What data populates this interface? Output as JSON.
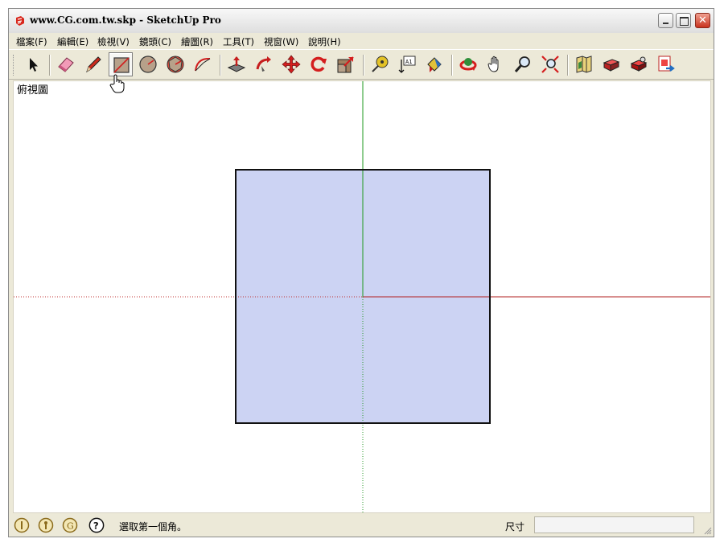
{
  "window": {
    "title": "www.CG.com.tw.skp - SketchUp Pro",
    "accent": "#cd2b1e"
  },
  "menu": [
    {
      "label": "檔案(F)"
    },
    {
      "label": "編輯(E)"
    },
    {
      "label": "檢視(V)"
    },
    {
      "label": "鏡頭(C)"
    },
    {
      "label": "繪圖(R)"
    },
    {
      "label": "工具(T)"
    },
    {
      "label": "視窗(W)"
    },
    {
      "label": "說明(H)"
    }
  ],
  "toolbar": {
    "tools": [
      "select-icon",
      "eraser-icon",
      "pencil-icon",
      "rectangle-icon",
      "circle-icon",
      "polygon-icon",
      "arc-icon",
      "push-pull-icon",
      "follow-me-icon",
      "move-icon",
      "rotate-icon",
      "scale-icon",
      "tape-measure-icon",
      "text-icon",
      "paint-bucket-icon",
      "orbit-icon",
      "pan-icon",
      "zoom-icon",
      "zoom-extents-icon",
      "get-models-icon",
      "share-model-icon",
      "share-component-icon",
      "send-to-layout-icon"
    ],
    "active_tool": "rectangle-icon"
  },
  "canvas": {
    "view_label": "俯視圖",
    "face_color": "#ccd3f3",
    "red_axis_color": "#b21f1f",
    "green_axis_color": "#1f9a1f"
  },
  "status": {
    "message": "選取第一個角。",
    "measure_label": "尺寸",
    "measure_value": ""
  }
}
